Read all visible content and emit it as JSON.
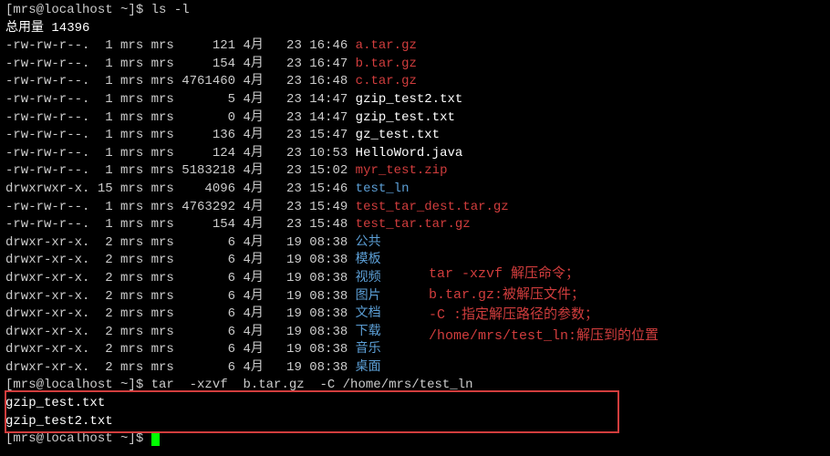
{
  "lines": {
    "l0": "[mrs@localhost ~]$ ls -l",
    "l1": "总用量 14396",
    "files": [
      {
        "perms": "-rw-rw-r--.",
        "links": " 1",
        "owner": "mrs",
        "group": "mrs",
        "size": "     121",
        "month": "4月",
        "day": " 23",
        "time": "16:46",
        "name": "a.tar.gz",
        "color": "red"
      },
      {
        "perms": "-rw-rw-r--.",
        "links": " 1",
        "owner": "mrs",
        "group": "mrs",
        "size": "     154",
        "month": "4月",
        "day": " 23",
        "time": "16:47",
        "name": "b.tar.gz",
        "color": "red"
      },
      {
        "perms": "-rw-rw-r--.",
        "links": " 1",
        "owner": "mrs",
        "group": "mrs",
        "size": " 4761460",
        "month": "4月",
        "day": " 23",
        "time": "16:48",
        "name": "c.tar.gz",
        "color": "red"
      },
      {
        "perms": "-rw-rw-r--.",
        "links": " 1",
        "owner": "mrs",
        "group": "mrs",
        "size": "       5",
        "month": "4月",
        "day": " 23",
        "time": "14:47",
        "name": "gzip_test2.txt",
        "color": "white"
      },
      {
        "perms": "-rw-rw-r--.",
        "links": " 1",
        "owner": "mrs",
        "group": "mrs",
        "size": "       0",
        "month": "4月",
        "day": " 23",
        "time": "14:47",
        "name": "gzip_test.txt",
        "color": "white"
      },
      {
        "perms": "-rw-rw-r--.",
        "links": " 1",
        "owner": "mrs",
        "group": "mrs",
        "size": "     136",
        "month": "4月",
        "day": " 23",
        "time": "15:47",
        "name": "gz_test.txt",
        "color": "white"
      },
      {
        "perms": "-rw-rw-r--.",
        "links": " 1",
        "owner": "mrs",
        "group": "mrs",
        "size": "     124",
        "month": "4月",
        "day": " 23",
        "time": "10:53",
        "name": "HelloWord.java",
        "color": "white"
      },
      {
        "perms": "-rw-rw-r--.",
        "links": " 1",
        "owner": "mrs",
        "group": "mrs",
        "size": " 5183218",
        "month": "4月",
        "day": " 23",
        "time": "15:02",
        "name": "myr_test.zip",
        "color": "red"
      },
      {
        "perms": "drwxrwxr-x.",
        "links": "15",
        "owner": "mrs",
        "group": "mrs",
        "size": "    4096",
        "month": "4月",
        "day": " 23",
        "time": "15:46",
        "name": "test_ln",
        "color": "blue"
      },
      {
        "perms": "-rw-rw-r--.",
        "links": " 1",
        "owner": "mrs",
        "group": "mrs",
        "size": " 4763292",
        "month": "4月",
        "day": " 23",
        "time": "15:49",
        "name": "test_tar_dest.tar.gz",
        "color": "red"
      },
      {
        "perms": "-rw-rw-r--.",
        "links": " 1",
        "owner": "mrs",
        "group": "mrs",
        "size": "     154",
        "month": "4月",
        "day": " 23",
        "time": "15:48",
        "name": "test_tar.tar.gz",
        "color": "red"
      },
      {
        "perms": "drwxr-xr-x.",
        "links": " 2",
        "owner": "mrs",
        "group": "mrs",
        "size": "       6",
        "month": "4月",
        "day": " 19",
        "time": "08:38",
        "name": "公共",
        "color": "blue"
      },
      {
        "perms": "drwxr-xr-x.",
        "links": " 2",
        "owner": "mrs",
        "group": "mrs",
        "size": "       6",
        "month": "4月",
        "day": " 19",
        "time": "08:38",
        "name": "模板",
        "color": "blue"
      },
      {
        "perms": "drwxr-xr-x.",
        "links": " 2",
        "owner": "mrs",
        "group": "mrs",
        "size": "       6",
        "month": "4月",
        "day": " 19",
        "time": "08:38",
        "name": "视频",
        "color": "blue"
      },
      {
        "perms": "drwxr-xr-x.",
        "links": " 2",
        "owner": "mrs",
        "group": "mrs",
        "size": "       6",
        "month": "4月",
        "day": " 19",
        "time": "08:38",
        "name": "图片",
        "color": "blue"
      },
      {
        "perms": "drwxr-xr-x.",
        "links": " 2",
        "owner": "mrs",
        "group": "mrs",
        "size": "       6",
        "month": "4月",
        "day": " 19",
        "time": "08:38",
        "name": "文档",
        "color": "blue"
      },
      {
        "perms": "drwxr-xr-x.",
        "links": " 2",
        "owner": "mrs",
        "group": "mrs",
        "size": "       6",
        "month": "4月",
        "day": " 19",
        "time": "08:38",
        "name": "下载",
        "color": "blue"
      },
      {
        "perms": "drwxr-xr-x.",
        "links": " 2",
        "owner": "mrs",
        "group": "mrs",
        "size": "       6",
        "month": "4月",
        "day": " 19",
        "time": "08:38",
        "name": "音乐",
        "color": "blue"
      },
      {
        "perms": "drwxr-xr-x.",
        "links": " 2",
        "owner": "mrs",
        "group": "mrs",
        "size": "       6",
        "month": "4月",
        "day": " 19",
        "time": "08:38",
        "name": "桌面",
        "color": "blue"
      }
    ],
    "cmd_tar": "[mrs@localhost ~]$ tar  -xzvf  b.tar.gz  -C /home/mrs/test_ln",
    "out1": "gzip_test.txt",
    "out2": "gzip_test2.txt",
    "final_prompt": "[mrs@localhost ~]$ "
  },
  "annotation": {
    "a1": "tar -xzvf 解压命令；",
    "a2": "b.tar.gz:被解压文件；",
    "a3": "-C :指定解压路径的参数；",
    "a4": "/home/mrs/test_ln:解压到的位置"
  }
}
